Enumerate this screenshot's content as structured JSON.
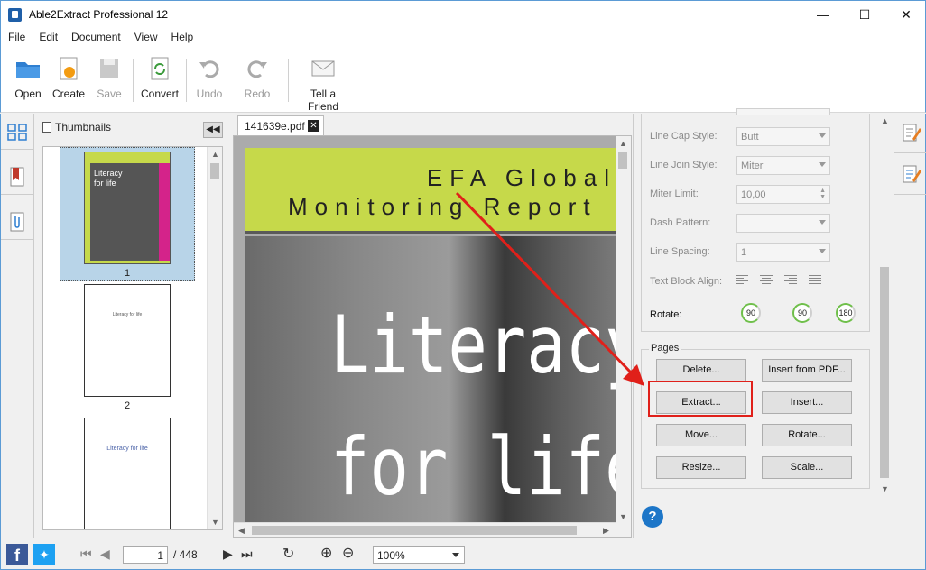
{
  "window": {
    "title": "Able2Extract Professional 12"
  },
  "menu": [
    "File",
    "Edit",
    "Document",
    "View",
    "Help"
  ],
  "toolbar": {
    "open": "Open",
    "create": "Create",
    "save": "Save",
    "convert": "Convert",
    "undo": "Undo",
    "redo": "Redo",
    "tell": "Tell a Friend"
  },
  "thumbnails": {
    "header": "Thumbnails",
    "pages": [
      {
        "num": "1",
        "title": "Literacy for life"
      },
      {
        "num": "2",
        "caption": "Literacy for life"
      },
      {
        "caption": "Literacy for life"
      }
    ]
  },
  "doc": {
    "tab": "141639e.pdf",
    "cover_line1": "EFA Global",
    "cover_line2": "Monitoring Report",
    "cover_title1": "Literacy",
    "cover_title2": "for life"
  },
  "props": {
    "line_cap": {
      "label": "Line Cap Style:",
      "value": "Butt"
    },
    "line_join": {
      "label": "Line Join Style:",
      "value": "Miter"
    },
    "miter": {
      "label": "Miter Limit:",
      "value": "10,00"
    },
    "dash": {
      "label": "Dash Pattern:",
      "value": ""
    },
    "spacing": {
      "label": "Line Spacing:",
      "value": "1"
    },
    "align": {
      "label": "Text Block Align:"
    },
    "rotate": {
      "label": "Rotate:",
      "values": [
        "90",
        "90",
        "180"
      ]
    }
  },
  "pages": {
    "legend": "Pages",
    "delete": "Delete...",
    "insert_pdf": "Insert from PDF...",
    "extract": "Extract...",
    "insert": "Insert...",
    "move": "Move...",
    "rotate": "Rotate...",
    "resize": "Resize...",
    "scale": "Scale..."
  },
  "status": {
    "page": "1",
    "total": "/ 448",
    "zoom": "100%"
  },
  "colors": {
    "highlight": "#e0201a",
    "accent": "#1d76c8"
  }
}
